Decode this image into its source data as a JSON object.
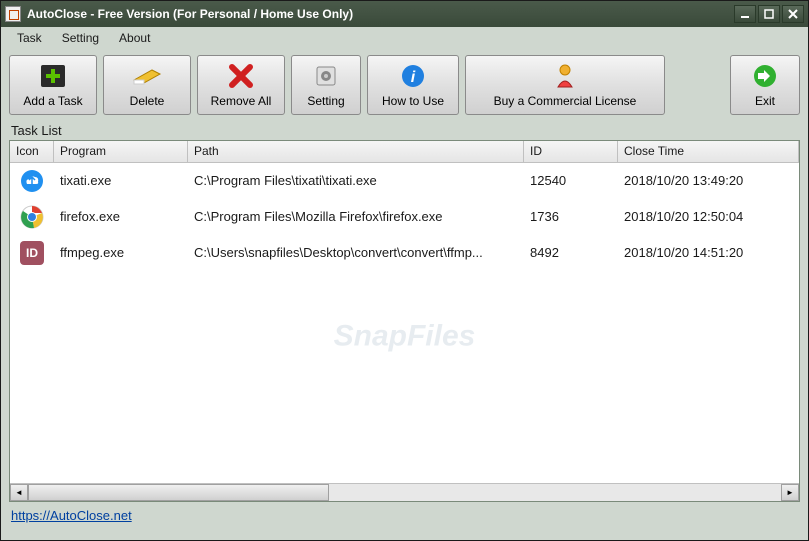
{
  "window": {
    "title": "AutoClose - Free Version (For Personal / Home Use Only)"
  },
  "menu": {
    "task": "Task",
    "setting": "Setting",
    "about": "About"
  },
  "toolbar": {
    "add": "Add a Task",
    "delete": "Delete",
    "remove_all": "Remove All",
    "setting": "Setting",
    "how_to_use": "How to Use",
    "buy": "Buy a Commercial License",
    "exit": "Exit"
  },
  "tasklist_label": "Task List",
  "columns": {
    "icon": "Icon",
    "program": "Program",
    "path": "Path",
    "id": "ID",
    "close_time": "Close Time"
  },
  "rows": [
    {
      "program": "tixati.exe",
      "path": "C:\\Program Files\\tixati\\tixati.exe",
      "id": "12540",
      "close_time": "2018/10/20 13:49:20",
      "icon_name": "cloud-upload"
    },
    {
      "program": "firefox.exe",
      "path": "C:\\Program Files\\Mozilla Firefox\\firefox.exe",
      "id": "1736",
      "close_time": "2018/10/20 12:50:04",
      "icon_name": "chrome"
    },
    {
      "program": "ffmpeg.exe",
      "path": "C:\\Users\\snapfiles\\Desktop\\convert\\convert\\ffmp...",
      "id": "8492",
      "close_time": "2018/10/20 14:51:20",
      "icon_name": "id"
    }
  ],
  "watermark": "SnapFiles",
  "footer_link": "https://AutoClose.net"
}
